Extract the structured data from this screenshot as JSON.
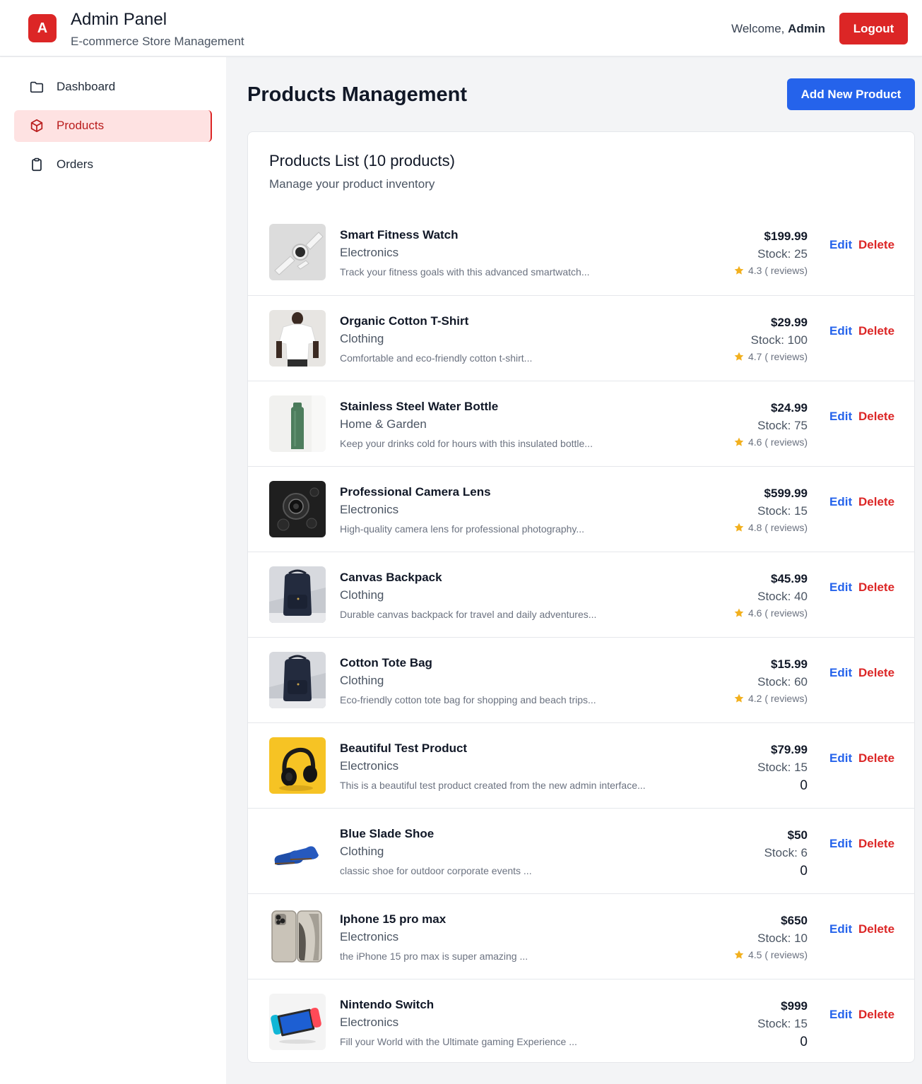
{
  "header": {
    "logo_letter": "A",
    "title": "Admin Panel",
    "subtitle": "E-commerce Store Management",
    "welcome_prefix": "Welcome, ",
    "welcome_user": "Admin",
    "logout_label": "Logout"
  },
  "sidebar": {
    "items": [
      {
        "label": "Dashboard",
        "icon": "folder-icon"
      },
      {
        "label": "Products",
        "icon": "cube-icon",
        "active": true
      },
      {
        "label": "Orders",
        "icon": "clipboard-icon"
      }
    ]
  },
  "main": {
    "title": "Products Management",
    "add_button_label": "Add New Product",
    "list_title": "Products List (10 products)",
    "list_subtitle": "Manage your product inventory"
  },
  "colors": {
    "brand_red": "#dc2626",
    "primary_blue": "#2563eb",
    "star": "#f2b01e"
  },
  "products": [
    {
      "name": "Smart Fitness Watch",
      "category": "Electronics",
      "description": "Track your fitness goals with this advanced smartwatch...",
      "price": "$199.99",
      "stock": "Stock: 25",
      "rating": "4.3 ( reviews)",
      "zero": null,
      "image": "watch"
    },
    {
      "name": "Organic Cotton T-Shirt",
      "category": "Clothing",
      "description": "Comfortable and eco-friendly cotton t-shirt...",
      "price": "$29.99",
      "stock": "Stock: 100",
      "rating": "4.7 ( reviews)",
      "zero": null,
      "image": "tshirt"
    },
    {
      "name": "Stainless Steel Water Bottle",
      "category": "Home & Garden",
      "description": "Keep your drinks cold for hours with this insulated bottle...",
      "price": "$24.99",
      "stock": "Stock: 75",
      "rating": "4.6 ( reviews)",
      "zero": null,
      "image": "bottle"
    },
    {
      "name": "Professional Camera Lens",
      "category": "Electronics",
      "description": "High-quality camera lens for professional photography...",
      "price": "$599.99",
      "stock": "Stock: 15",
      "rating": "4.8 ( reviews)",
      "zero": null,
      "image": "lens"
    },
    {
      "name": "Canvas Backpack",
      "category": "Clothing",
      "description": "Durable canvas backpack for travel and daily adventures...",
      "price": "$45.99",
      "stock": "Stock: 40",
      "rating": "4.6 ( reviews)",
      "zero": null,
      "image": "backpack"
    },
    {
      "name": "Cotton Tote Bag",
      "category": "Clothing",
      "description": "Eco-friendly cotton tote bag for shopping and beach trips...",
      "price": "$15.99",
      "stock": "Stock: 60",
      "rating": "4.2 ( reviews)",
      "zero": null,
      "image": "backpack"
    },
    {
      "name": "Beautiful Test Product",
      "category": "Electronics",
      "description": "This is a beautiful test product created from the new admin interface...",
      "price": "$79.99",
      "stock": "Stock: 15",
      "rating": null,
      "zero": "0",
      "image": "headphones"
    },
    {
      "name": "Blue Slade Shoe",
      "category": "Clothing",
      "description": "classic shoe for outdoor corporate events ...",
      "price": "$50",
      "stock": "Stock: 6",
      "rating": null,
      "zero": "0",
      "image": "shoe"
    },
    {
      "name": "Iphone 15 pro max",
      "category": "Electronics",
      "description": "the iPhone 15 pro max is super amazing ...",
      "price": "$650",
      "stock": "Stock: 10",
      "rating": "4.5 ( reviews)",
      "zero": null,
      "image": "phone"
    },
    {
      "name": "Nintendo Switch",
      "category": "Electronics",
      "description": "Fill your World with the Ultimate gaming Experience ...",
      "price": "$999",
      "stock": "Stock: 15",
      "rating": null,
      "zero": "0",
      "image": "switch"
    }
  ],
  "actions": {
    "edit_label": "Edit",
    "delete_label": "Delete"
  }
}
